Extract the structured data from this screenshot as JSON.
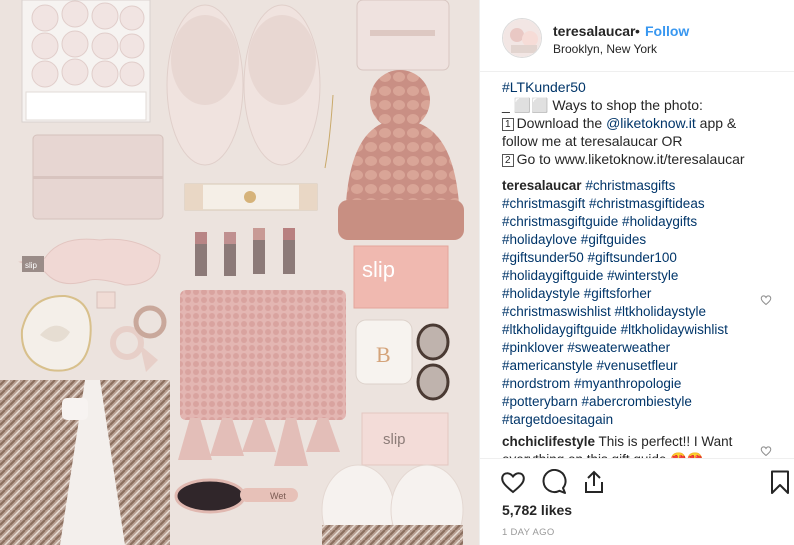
{
  "post": {
    "username": "teresalaucar",
    "separator": "•",
    "follow_label": "Follow",
    "location": "Brooklyn, New York",
    "caption": {
      "hashtag": "#LTKunder50",
      "line2": "_ ⬜⬜ Ways to shop the photo:",
      "line3_num": "1",
      "line3_a": "Download the ",
      "line3_mention": "@liketoknow.it",
      "line3_b": " app &",
      "line4": "follow me at teresalaucar OR",
      "line5_num": "2",
      "line5": "Go to www.liketoknow.it/teresalaucar"
    },
    "tags_comment": {
      "username": "teresalaucar",
      "lines": [
        "#christmasgifts",
        "#christmasgift #christmasgiftideas",
        "#christmasgiftguide #holidaygifts",
        "#holidaylove #giftguides",
        "#giftsunder50 #giftsunder100",
        "#holidaygiftguide #winterstyle",
        "#holidaystyle #giftsforher",
        "#christmaswishlist #ltkholidaystyle",
        "#ltkholidaygiftguide #ltkholidaywishlist",
        "#pinklover #sweaterweather",
        "#americanstyle #venusetfleur",
        "#nordstrom #myanthropologie",
        "#potterybarn #abercrombiestyle",
        "#targetdoesitagain"
      ]
    },
    "comment2": {
      "username": "chchiclifestyle",
      "text": " This is perfect!! I Want",
      "text_line2": "everything on this gift guide 😍😍"
    },
    "likes": "5,782 likes",
    "time_ago": "1 DAY AGO",
    "photo_text": {
      "slip_box": "slip",
      "slip_case": "slip",
      "slip_mask": "slip",
      "candle": "B",
      "brush": "Wet"
    },
    "icons": {
      "like": "heart-icon",
      "comment": "comment-icon",
      "share": "share-icon",
      "save": "bookmark-icon"
    },
    "colors": {
      "link": "#3897f0",
      "hashtag": "#003569",
      "text": "#262626",
      "muted": "#999999",
      "photo_bg": "#ece3de"
    }
  }
}
